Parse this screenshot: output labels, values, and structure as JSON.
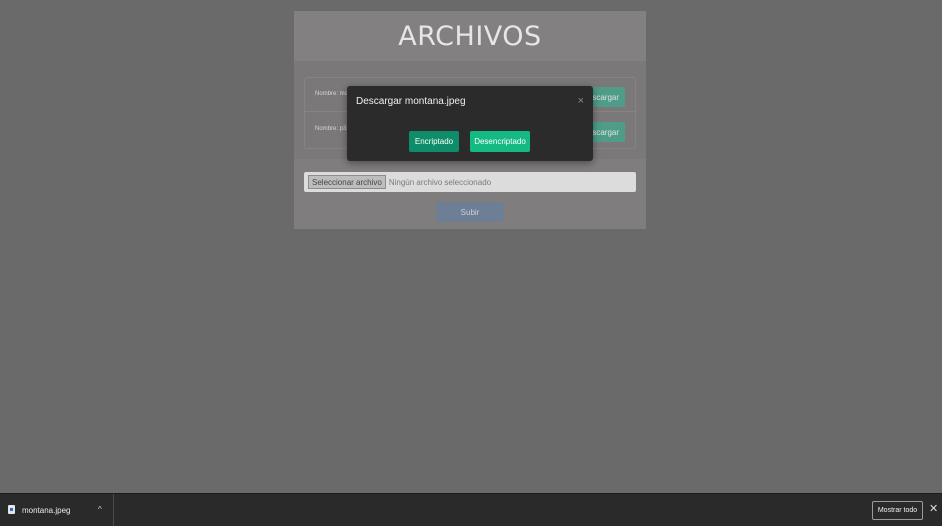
{
  "page": {
    "title": "ARCHIVOS",
    "files": [
      {
        "name_label": "Nombre: mon",
        "button_label": "escargar"
      },
      {
        "name_label": "Nombre: p3.p",
        "button_label": "escargar"
      }
    ],
    "upload": {
      "choose_label": "Seleccionar archivo",
      "status": "Ningún archivo seleccionado",
      "submit_label": "Subir"
    }
  },
  "modal": {
    "title": "Descargar montana.jpeg",
    "close_symbol": "×",
    "encrypted_label": "Encriptado",
    "decrypted_label": "Desencriptado"
  },
  "download_shelf": {
    "file_name": "montana.jpeg",
    "chevron": "^",
    "show_all_label": "Mostrar todo",
    "close_symbol": "✕"
  },
  "colors": {
    "encrypted_button": "#0f8d6a",
    "decrypted_button": "#14b984",
    "modal_bg": "#2b2b2b",
    "shelf_bg": "#2a2a2a"
  }
}
